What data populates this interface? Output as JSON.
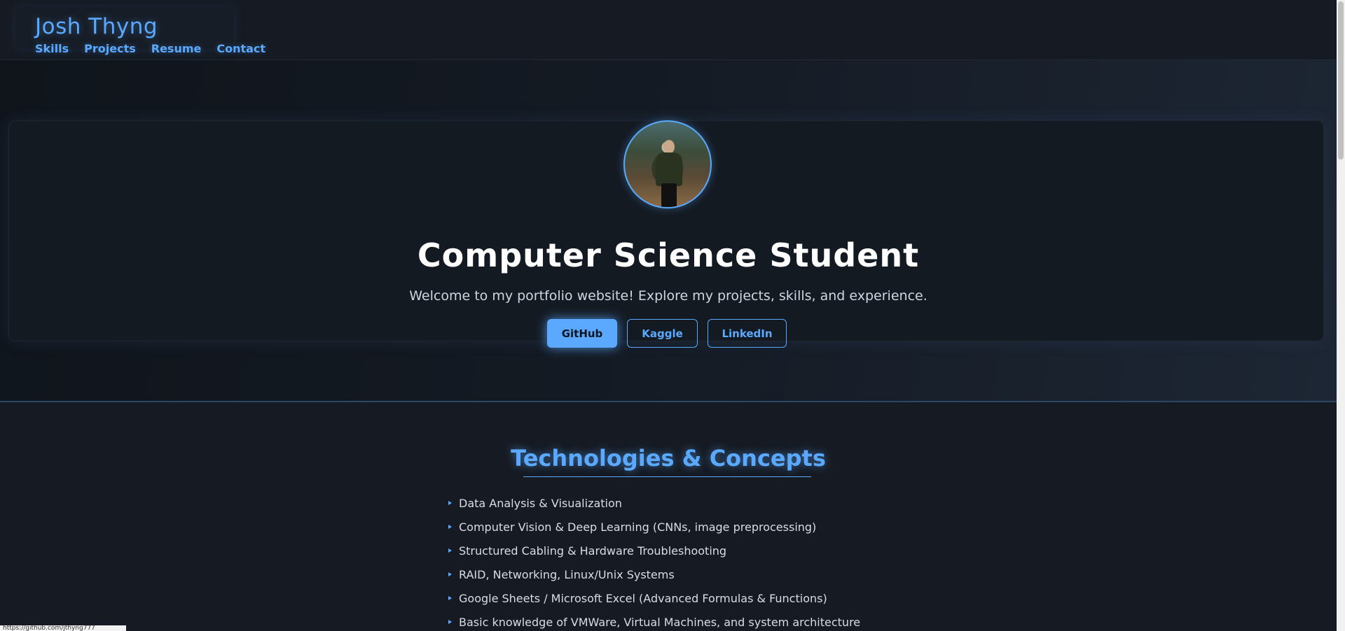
{
  "header": {
    "brand": "Josh Thyng",
    "nav": [
      "Skills",
      "Projects",
      "Resume",
      "Contact"
    ]
  },
  "hero": {
    "title": "Computer Science Student",
    "subtitle": "Welcome to my portfolio website! Explore my projects, skills, and experience.",
    "buttons": {
      "github": "GitHub",
      "kaggle": "Kaggle",
      "linkedin": "LinkedIn"
    }
  },
  "skills": {
    "title": "Technologies & Concepts",
    "items": [
      "Data Analysis & Visualization",
      "Computer Vision & Deep Learning (CNNs, image preprocessing)",
      "Structured Cabling & Hardware Troubleshooting",
      "RAID, Networking, Linux/Unix Systems",
      "Google Sheets / Microsoft Excel (Advanced Formulas & Functions)",
      "Basic knowledge of VMWare, Virtual Machines, and system architecture"
    ]
  },
  "status": "https://github.com/jthyng777",
  "colors": {
    "accent": "#5aa9ff",
    "background": "#161b23"
  }
}
